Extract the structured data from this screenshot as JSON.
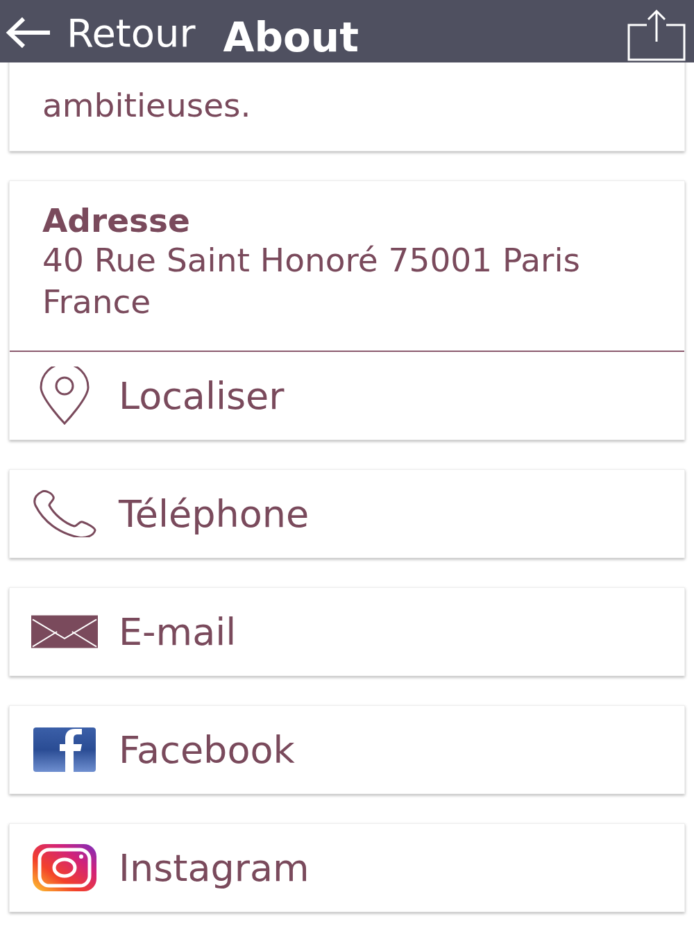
{
  "header": {
    "back_label": "Retour",
    "title": "About"
  },
  "description": {
    "lines": [
      "ambitieuses."
    ]
  },
  "address": {
    "label": "Adresse",
    "value": "40 Rue Saint Honoré 75001 Paris France"
  },
  "actions": [
    {
      "kind": "locate",
      "label": "Localiser"
    },
    {
      "kind": "phone",
      "label": "Téléphone"
    },
    {
      "kind": "email",
      "label": "E-mail"
    },
    {
      "kind": "facebook",
      "label": "Facebook"
    },
    {
      "kind": "instagram",
      "label": "Instagram"
    }
  ]
}
